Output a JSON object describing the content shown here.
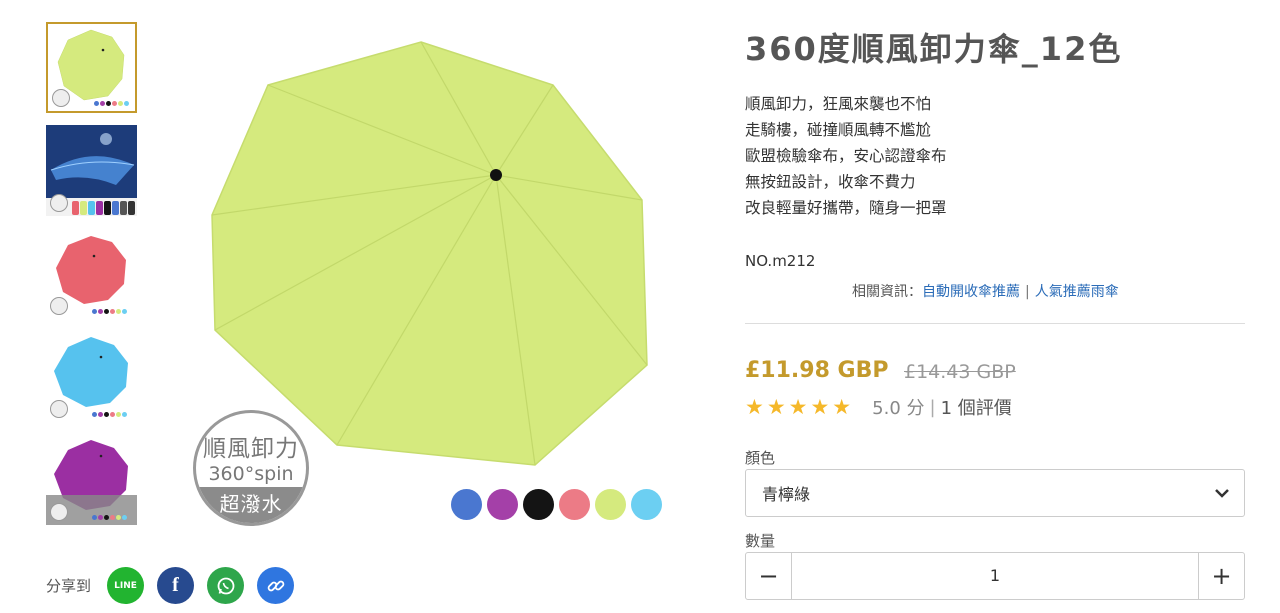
{
  "product": {
    "title": "360度順風卸力傘_12色",
    "description": [
      "順風卸力，狂風來襲也不怕",
      "走騎樓，碰撞順風轉不尷尬",
      "歐盟檢驗傘布，安心認證傘布",
      "無按鈕設計，收傘不費力",
      "改良輕量好攜帶，隨身一把罩"
    ],
    "sku": "NO.m212",
    "related_label": "相關資訊：",
    "related_links": [
      "自動開收傘推薦",
      "人氣推薦雨傘"
    ],
    "related_separator": "|",
    "price": "£11.98 GBP",
    "original_price": "£14.43 GBP",
    "stars": "★★★★★",
    "rating_score": "5.0 分",
    "rating_divider": "|",
    "review_count": "1 個評價",
    "rating_value": 5,
    "rating_max": 5
  },
  "image_badge": {
    "line1": "順風卸力",
    "line2": "360°spin",
    "line3": "超潑水"
  },
  "options": {
    "color_label": "顏色",
    "color_value": "青檸綠",
    "quantity_label": "數量",
    "quantity_value": "1",
    "minus_icon": "−",
    "plus_icon": "+"
  },
  "share": {
    "label": "分享到",
    "line_label": "LINE",
    "facebook_glyph": "f",
    "buttons": [
      "line-icon",
      "facebook-icon",
      "whatsapp-icon",
      "link-icon"
    ]
  },
  "colors": {
    "accent": "#c49a2c",
    "umbrella_main": "#d5ea7e",
    "link": "#2b6cb8",
    "star": "#f5b82a",
    "swatches": [
      "#4a77d0",
      "#a440a8",
      "#141414",
      "#ec7b86",
      "#d5ea7e",
      "#6ccff2"
    ]
  },
  "thumbnails": [
    {
      "name": "thumb-lime-umbrella",
      "color": "#d5ea7e"
    },
    {
      "name": "thumb-umbrella-banner",
      "color": "#4a8ad8"
    },
    {
      "name": "thumb-red-umbrella",
      "color": "#e8636e"
    },
    {
      "name": "thumb-blue-umbrella",
      "color": "#56c2ee"
    },
    {
      "name": "thumb-purple-umbrella",
      "color": "#9b2fa2"
    }
  ]
}
